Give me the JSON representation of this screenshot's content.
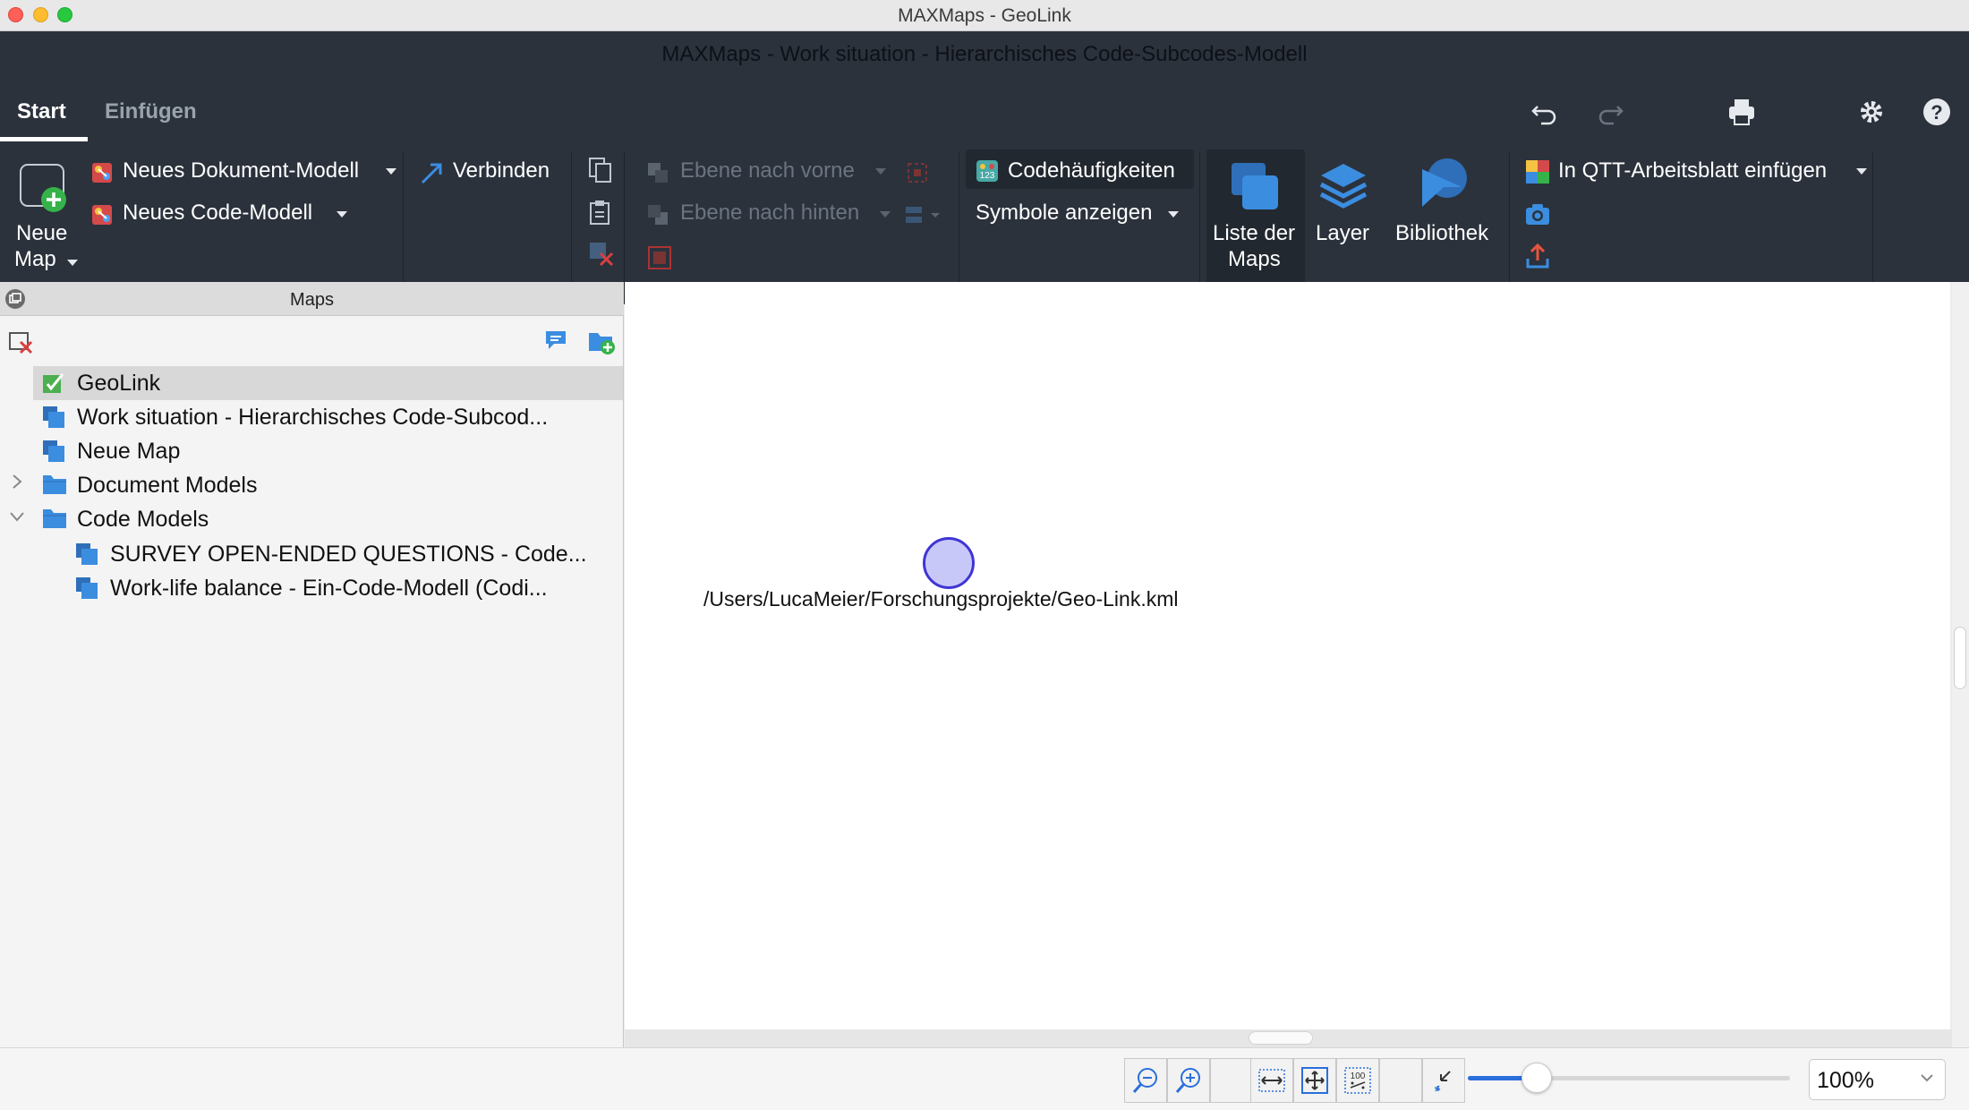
{
  "window": {
    "title": "MAXMaps - GeoLink",
    "document_title": "MAXMaps - Work situation - Hierarchisches Code-Subcodes-Modell"
  },
  "tabs": [
    {
      "label": "Start",
      "active": true
    },
    {
      "label": "Einfügen",
      "active": false
    }
  ],
  "toolbar_right_icons": [
    "undo-icon",
    "redo-icon",
    "print-icon",
    "gear-icon",
    "help-icon"
  ],
  "ribbon": {
    "neue_map": {
      "line1": "Neue",
      "line2": "Map"
    },
    "neues_dokument_modell": "Neues Dokument-Modell",
    "neues_code_modell": "Neues Code-Modell",
    "verbinden": "Verbinden",
    "ebene_nach_vorne": "Ebene nach vorne",
    "ebene_nach_hinten": "Ebene nach hinten",
    "codehaeufigkeiten": "Codehäufigkeiten",
    "symbole_anzeigen": "Symbole anzeigen",
    "liste_der_maps": {
      "line1": "Liste der",
      "line2": "Maps"
    },
    "layer": "Layer",
    "bibliothek": "Bibliothek",
    "qtt_einfuegen": "In QTT-Arbeitsblatt einfügen"
  },
  "panel": {
    "title": "Maps",
    "items": [
      {
        "label": "GeoLink",
        "icon": "geolink-map-icon",
        "selected": true
      },
      {
        "label": "Work situation - Hierarchisches Code-Subcod...",
        "icon": "map-icon"
      },
      {
        "label": "Neue Map",
        "icon": "map-icon"
      },
      {
        "label": "Document Models",
        "icon": "folder-icon",
        "expanded": false
      },
      {
        "label": "Code Models",
        "icon": "folder-icon",
        "expanded": true
      },
      {
        "label": "SURVEY OPEN-ENDED QUESTIONS - Code...",
        "icon": "map-icon"
      },
      {
        "label": "Work-life balance - Ein-Code-Modell (Codi...",
        "icon": "map-icon"
      }
    ]
  },
  "canvas": {
    "node_label": "/Users/LucaMeier/Forschungsprojekte/Geo-Link.kml",
    "node_fill": "#c8c8f8",
    "node_stroke": "#3f35d4"
  },
  "statusbar": {
    "zoom_value": "100%",
    "zoom_slider_level": 0.17
  },
  "colors": {
    "ribbon_bg": "#2b323c",
    "accent_blue": "#3b8de0"
  }
}
